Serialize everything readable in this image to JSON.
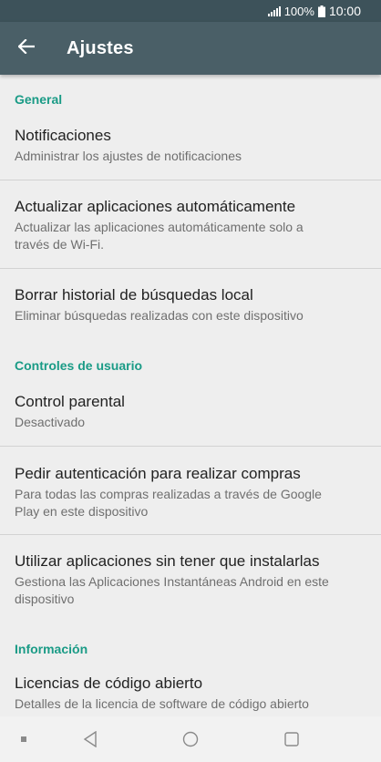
{
  "status_bar": {
    "battery": "100%",
    "time": "10:00",
    "icons": [
      "signal-icon",
      "battery-icon"
    ]
  },
  "app_bar": {
    "title": "Ajustes",
    "back_icon": "arrow-back-icon"
  },
  "sections": [
    {
      "header": "General",
      "items": [
        {
          "title": "Notificaciones",
          "subtitle": "Administrar los ajustes de notificaciones"
        },
        {
          "title": "Actualizar aplicaciones automáticamente",
          "subtitle_lines": [
            "Actualizar las aplicaciones automáticamente solo a",
            "través de Wi-Fi."
          ]
        },
        {
          "title": "Borrar historial de búsquedas local",
          "subtitle": "Eliminar búsquedas realizadas con este dispositivo"
        }
      ]
    },
    {
      "header": "Controles de usuario",
      "items": [
        {
          "title": "Control parental",
          "subtitle": "Desactivado"
        },
        {
          "title": "Pedir autenticación para realizar compras",
          "subtitle_lines": [
            "Para todas las compras realizadas a través de Google",
            "Play en este dispositivo"
          ]
        },
        {
          "title": "Utilizar aplicaciones sin tener que instalarlas",
          "subtitle_lines": [
            "Gestiona las Aplicaciones Instantáneas Android en este",
            "dispositivo"
          ]
        }
      ]
    },
    {
      "header": "Información",
      "items": [
        {
          "title": "Licencias de código abierto",
          "subtitle": "Detalles de la licencia de software de código abierto"
        }
      ]
    }
  ],
  "nav_bar": {
    "buttons": [
      "menu-dot-icon",
      "back-triangle-icon",
      "home-circle-icon",
      "recents-square-icon"
    ]
  },
  "colors": {
    "status_bar": "#3d525a",
    "app_bar": "#4a5f67",
    "accent": "#1a9b86",
    "background": "#eeeeee"
  }
}
